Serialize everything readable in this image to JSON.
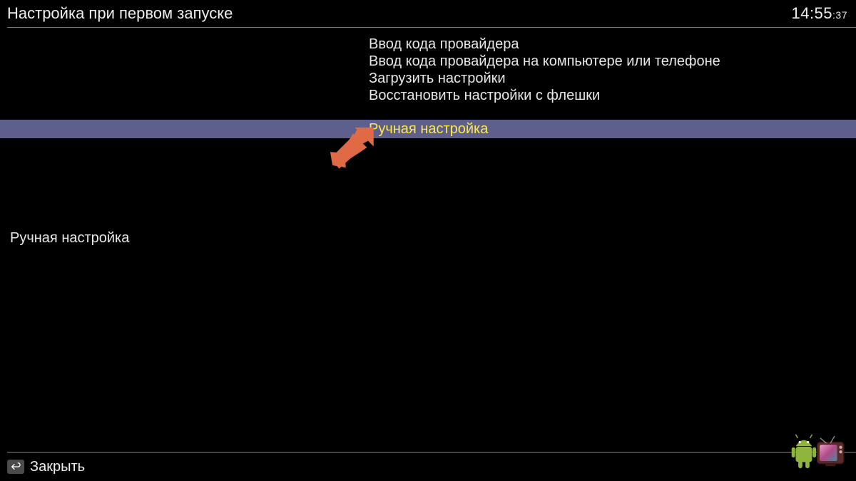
{
  "header": {
    "title": "Настройка при первом запуске",
    "clock_hm": "14:55",
    "clock_sec": ":37"
  },
  "menu": {
    "items": [
      {
        "label": "Ввод кода провайдера",
        "selected": false
      },
      {
        "label": "Ввод кода провайдера на компьютере или телефоне",
        "selected": false
      },
      {
        "label": "Загрузить настройки",
        "selected": false
      },
      {
        "label": "Восстановить настройки с флешки",
        "selected": false
      }
    ],
    "selected_item": {
      "label": "Ручная настройка"
    }
  },
  "description": "Ручная настройка",
  "footer": {
    "close_label": "Закрыть"
  }
}
